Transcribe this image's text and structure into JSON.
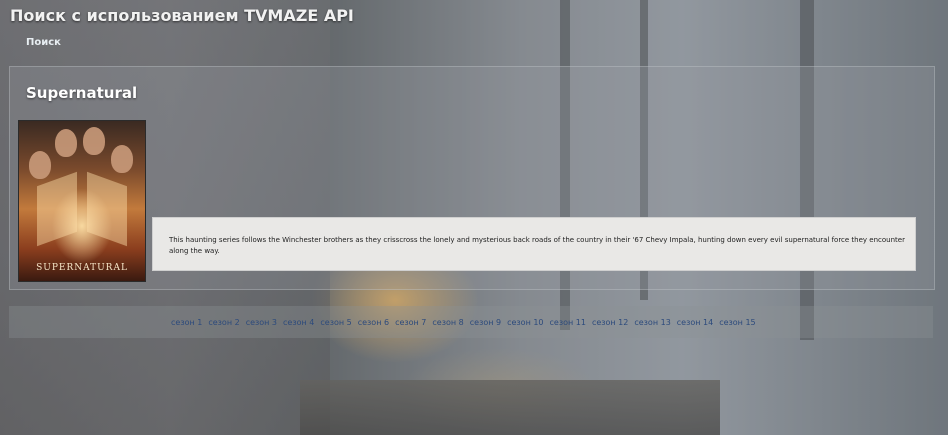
{
  "app": {
    "title": "Поиск с использованием TVMAZE API",
    "nav_search": "Поиск"
  },
  "show": {
    "title": "Supernatural",
    "poster_logo": "SUPERNATURAL",
    "summary": "This haunting series follows the Winchester brothers as they crisscross the lonely and mysterious back roads of the country in their '67 Chevy Impala, hunting down every evil supernatural force they encounter along the way."
  },
  "seasons": [
    "сезон 1",
    "сезон 2",
    "сезон 3",
    "сезон 4",
    "сезон 5",
    "сезон 6",
    "сезон 7",
    "сезон 8",
    "сезон 9",
    "сезон 10",
    "сезон 11",
    "сезон 12",
    "сезон 13",
    "сезон 14",
    "сезон 15"
  ]
}
